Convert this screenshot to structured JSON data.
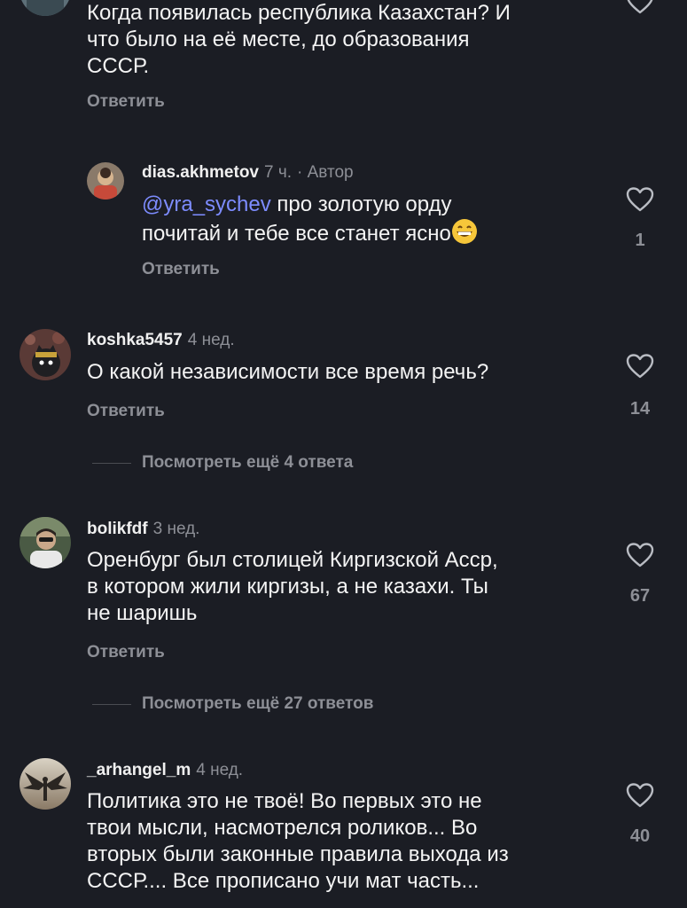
{
  "comments": [
    {
      "text_lines": [
        "Когда появилась республика Казахстан? И",
        "что было на её месте, до образования",
        "СССР."
      ],
      "reply_label": "Ответить"
    },
    {
      "username": "dias.akhmetov",
      "time": "7 ч.",
      "author_badge": "· Автор",
      "mention": "@yra_sychev",
      "line1_rest": " про золотую орду",
      "line2": "почитай и тебе все станет ясно",
      "emoji": "grinning-face-icon",
      "reply_label": "Ответить",
      "likes": "1"
    },
    {
      "username": "koshka5457",
      "time": "4 нед.",
      "text_lines": [
        "О какой независимости все время речь?"
      ],
      "reply_label": "Ответить",
      "likes": "14",
      "more_replies": "Посмотреть ещё 4 ответа"
    },
    {
      "username": "bolikfdf",
      "time": "3 нед.",
      "text_lines": [
        "Оренбург был столицей Киргизской Асср,",
        "в котором жили киргизы, а не казахи. Ты",
        "не шаришь"
      ],
      "reply_label": "Ответить",
      "likes": "67",
      "more_replies": "Посмотреть ещё 27 ответов"
    },
    {
      "username": "_arhangel_m",
      "time": "4 нед.",
      "text_lines": [
        "Политика это не твоё! Во первых это не",
        "твои мысли, насмотрелся роликов... Во",
        "вторых были законные правила выхода из",
        "СССР.... Все прописано учи мат часть..."
      ],
      "likes": "40"
    }
  ],
  "colors": {
    "background": "#1b1d24",
    "text": "#f4f4f4",
    "muted": "#8d8f96",
    "mention": "#7d8cff"
  }
}
